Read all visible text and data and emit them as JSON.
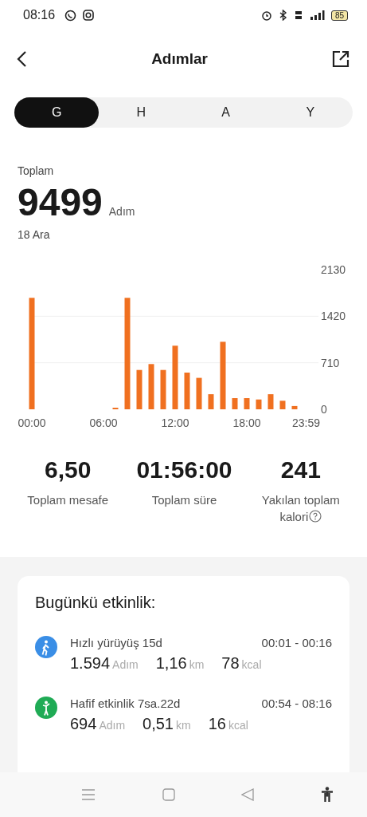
{
  "status_bar": {
    "time": "08:16",
    "battery": "85"
  },
  "header": {
    "title": "Adımlar"
  },
  "tabs": [
    {
      "label": "G",
      "selected": true
    },
    {
      "label": "H",
      "selected": false
    },
    {
      "label": "A",
      "selected": false
    },
    {
      "label": "Y",
      "selected": false
    }
  ],
  "summary": {
    "label": "Toplam",
    "value": "9499",
    "unit": "Adım",
    "date": "18 Ara"
  },
  "chart": {
    "chart_data": {
      "type": "bar",
      "x": [
        0,
        1,
        2,
        3,
        4,
        5,
        6,
        7,
        8,
        9,
        10,
        11,
        12,
        13,
        14,
        15,
        16,
        17,
        18,
        19,
        20,
        21,
        22,
        23
      ],
      "series": [
        {
          "color": "#f07020",
          "values": [
            1700,
            0,
            0,
            0,
            0,
            0,
            0,
            10,
            1700,
            600,
            690,
            600,
            970,
            560,
            480,
            230,
            1030,
            170,
            170,
            150,
            230,
            130,
            50,
            0
          ]
        }
      ],
      "xlim": [
        0,
        24
      ],
      "ylim": [
        0,
        2130
      ],
      "yticks": [
        0,
        710,
        1420,
        2130
      ],
      "xticks": [
        {
          "value": 0,
          "label": "00:00"
        },
        {
          "value": 6,
          "label": "06:00"
        },
        {
          "value": 12,
          "label": "12:00"
        },
        {
          "value": 18,
          "label": "18:00"
        },
        {
          "value": 23.98,
          "label": "23:59"
        }
      ]
    }
  },
  "stats": [
    {
      "value": "6,50",
      "label": "Toplam mesafe",
      "help": false
    },
    {
      "value": "01:56:00",
      "label": "Toplam süre",
      "help": false
    },
    {
      "value": "241",
      "label": "Yakılan toplam kalori",
      "help": true
    }
  ],
  "activity": {
    "title": "Bugünkü etkinlik:",
    "items": [
      {
        "kind": "walk",
        "color": "#3a8ee6",
        "name": "Hızlı yürüyüş 15d",
        "time": "00:01 - 00:16",
        "steps": "1.594",
        "steps_unit": "Adım",
        "distance": "1,16",
        "distance_unit": "km",
        "calories": "78",
        "calories_unit": "kcal"
      },
      {
        "kind": "light",
        "color": "#1fab55",
        "name": "Hafif etkinlik 7sa.22d",
        "time": "00:54 - 08:16",
        "steps": "694",
        "steps_unit": "Adım",
        "distance": "0,51",
        "distance_unit": "km",
        "calories": "16",
        "calories_unit": "kcal"
      }
    ]
  }
}
